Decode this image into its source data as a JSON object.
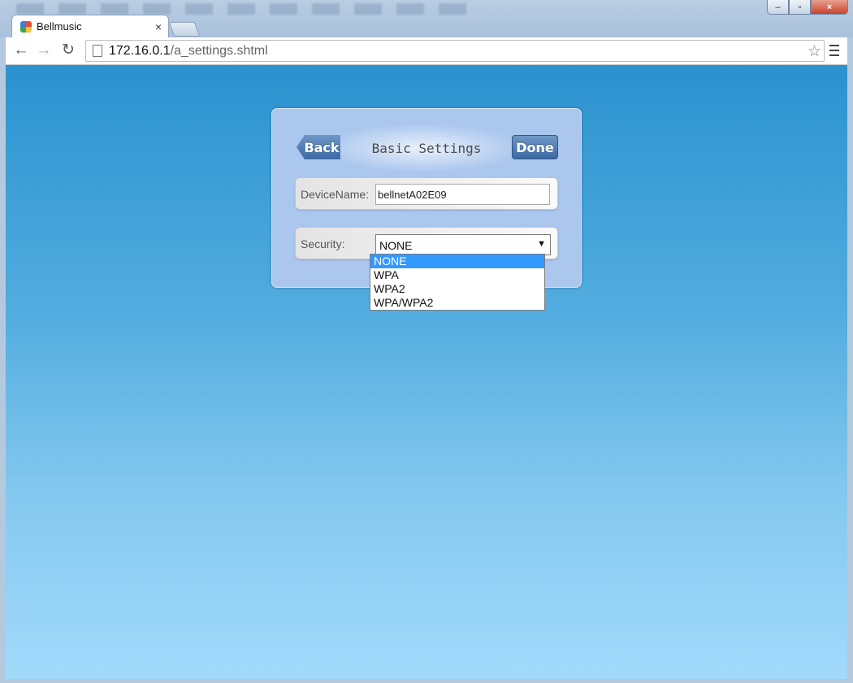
{
  "browser": {
    "tab_title": "Bellmusic",
    "tab_close": "×",
    "url_host": "172.16.0.1",
    "url_path": "/a_settings.shtml",
    "back_glyph": "←",
    "forward_glyph": "→",
    "reload_glyph": "↻",
    "star_glyph": "☆",
    "window_minimize": "–",
    "window_maximize": "▫",
    "window_close": "×"
  },
  "panel": {
    "back_label": "Back",
    "title": "Basic Settings",
    "done_label": "Done"
  },
  "device": {
    "label": "DeviceName:",
    "value": "bellnetA02E09"
  },
  "security": {
    "label": "Security:",
    "selected": "NONE",
    "arrow": "▼",
    "options": [
      "NONE",
      "WPA",
      "WPA2",
      "WPA/WPA2"
    ]
  },
  "colors": {
    "accent_button": "#3c6aa3",
    "selected_option": "#3399ff",
    "background_top": "#2b92cf",
    "background_bottom": "#a2dafb"
  }
}
